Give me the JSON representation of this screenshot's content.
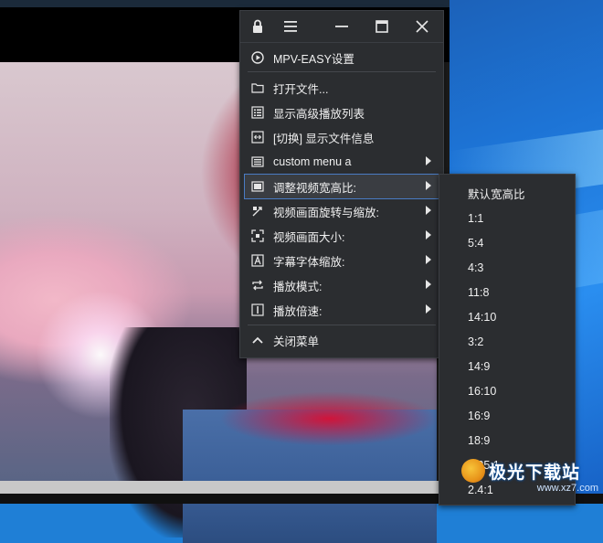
{
  "menu": {
    "titlebar": {
      "lock_icon": "lock-icon",
      "menu_icon": "hamburger-icon",
      "minimize_icon": "minimize-icon",
      "maximize_icon": "maximize-icon",
      "close_icon": "close-icon"
    },
    "items": [
      {
        "label": "MPV-EASY设置",
        "icon": "play-circle-icon",
        "submenu": false
      },
      {
        "label": "打开文件...",
        "icon": "folder-icon",
        "submenu": false
      },
      {
        "label": "显示高级播放列表",
        "icon": "list-icon",
        "submenu": false
      },
      {
        "label": "[切换] 显示文件信息",
        "icon": "resize-horizontal-icon",
        "submenu": false
      },
      {
        "label": "custom menu a",
        "icon": "custom-menu-icon",
        "submenu": true
      },
      {
        "label": "调整视频宽高比:",
        "icon": "aspect-ratio-icon",
        "submenu": true,
        "selected": true
      },
      {
        "label": "视频画面旋转与缩放:",
        "icon": "rotate-icon",
        "submenu": true
      },
      {
        "label": "视频画面大小:",
        "icon": "fullscreen-icon",
        "submenu": true
      },
      {
        "label": "字幕字体缩放:",
        "icon": "font-icon",
        "submenu": true
      },
      {
        "label": "播放模式:",
        "icon": "repeat-icon",
        "submenu": true
      },
      {
        "label": "播放倍速:",
        "icon": "speed-icon",
        "submenu": true
      },
      {
        "label": "关闭菜单",
        "icon": "chevron-up-icon",
        "submenu": false
      }
    ]
  },
  "submenu": {
    "items": [
      "默认宽高比",
      "1:1",
      "5:4",
      "4:3",
      "11:8",
      "14:10",
      "3:2",
      "14:9",
      "16:10",
      "16:9",
      "18:9",
      "2.35:1",
      "2.4:1"
    ]
  },
  "watermark": {
    "text": "极光下载站",
    "url": "www.xz7.com"
  }
}
